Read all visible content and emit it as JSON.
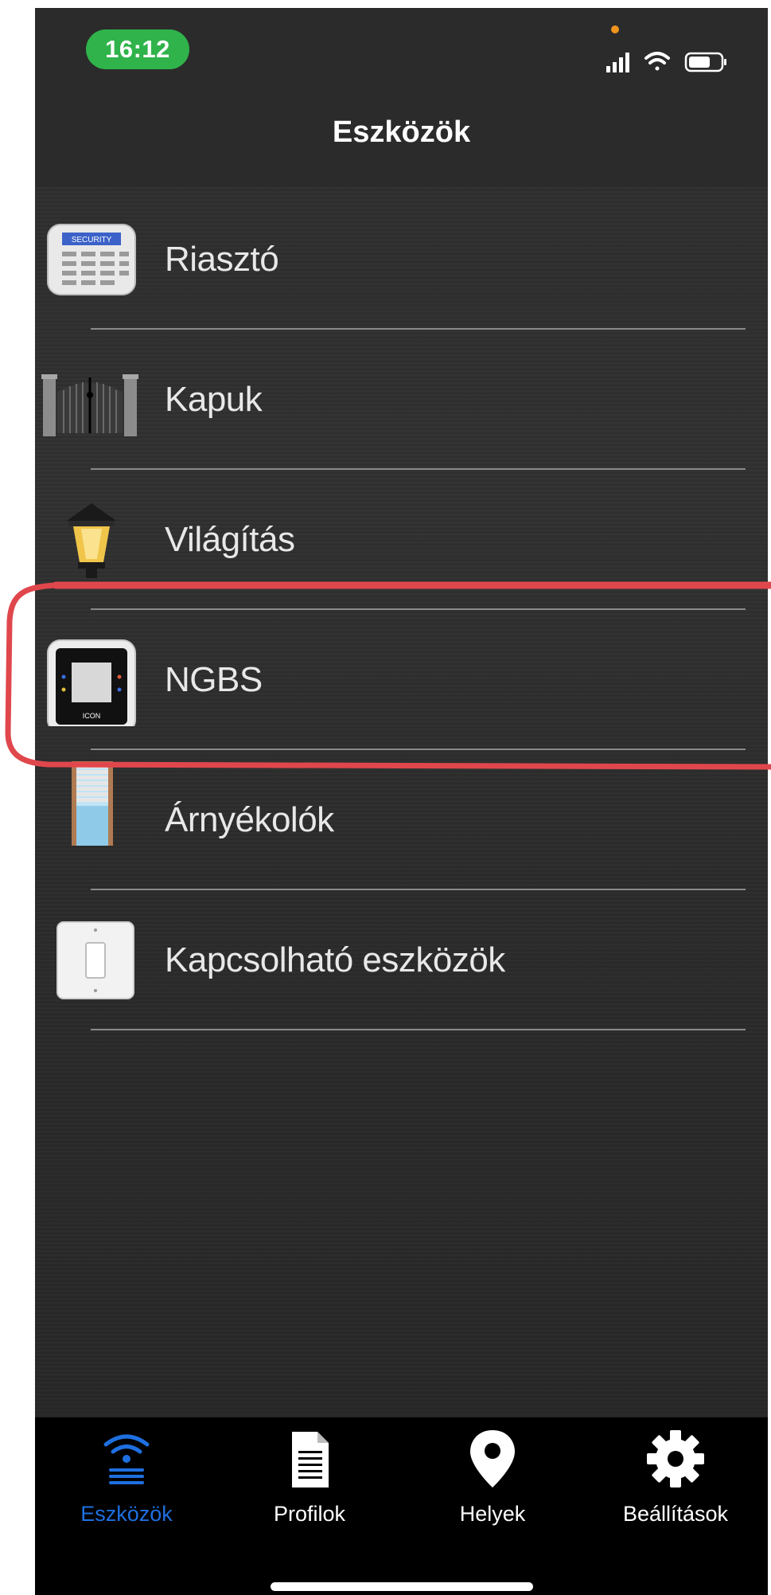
{
  "status_bar": {
    "time": "16:12"
  },
  "nav": {
    "title": "Eszközök"
  },
  "devices": [
    {
      "label": "Riasztó",
      "icon": "security-keypad-icon"
    },
    {
      "label": "Kapuk",
      "icon": "gate-icon"
    },
    {
      "label": "Világítás",
      "icon": "lantern-icon"
    },
    {
      "label": "NGBS",
      "icon": "ngbs-thermostat-icon"
    },
    {
      "label": "Árnyékolók",
      "icon": "window-blind-icon"
    },
    {
      "label": "Kapcsolható eszközök",
      "icon": "wall-switch-icon"
    }
  ],
  "keypad_icon_text": "SECURITY",
  "ngbs_icon_text": "ICON",
  "tabs": [
    {
      "label": "Eszközök",
      "icon": "wifi-devices-icon",
      "active": true
    },
    {
      "label": "Profilok",
      "icon": "document-icon",
      "active": false
    },
    {
      "label": "Helyek",
      "icon": "location-pin-icon",
      "active": false
    },
    {
      "label": "Beállítások",
      "icon": "gear-icon",
      "active": false
    }
  ],
  "colors": {
    "active_tab": "#1e6fe0",
    "time_pill": "#2fb34a",
    "annotation": "#e0474c",
    "background": "#2c2c2c"
  }
}
